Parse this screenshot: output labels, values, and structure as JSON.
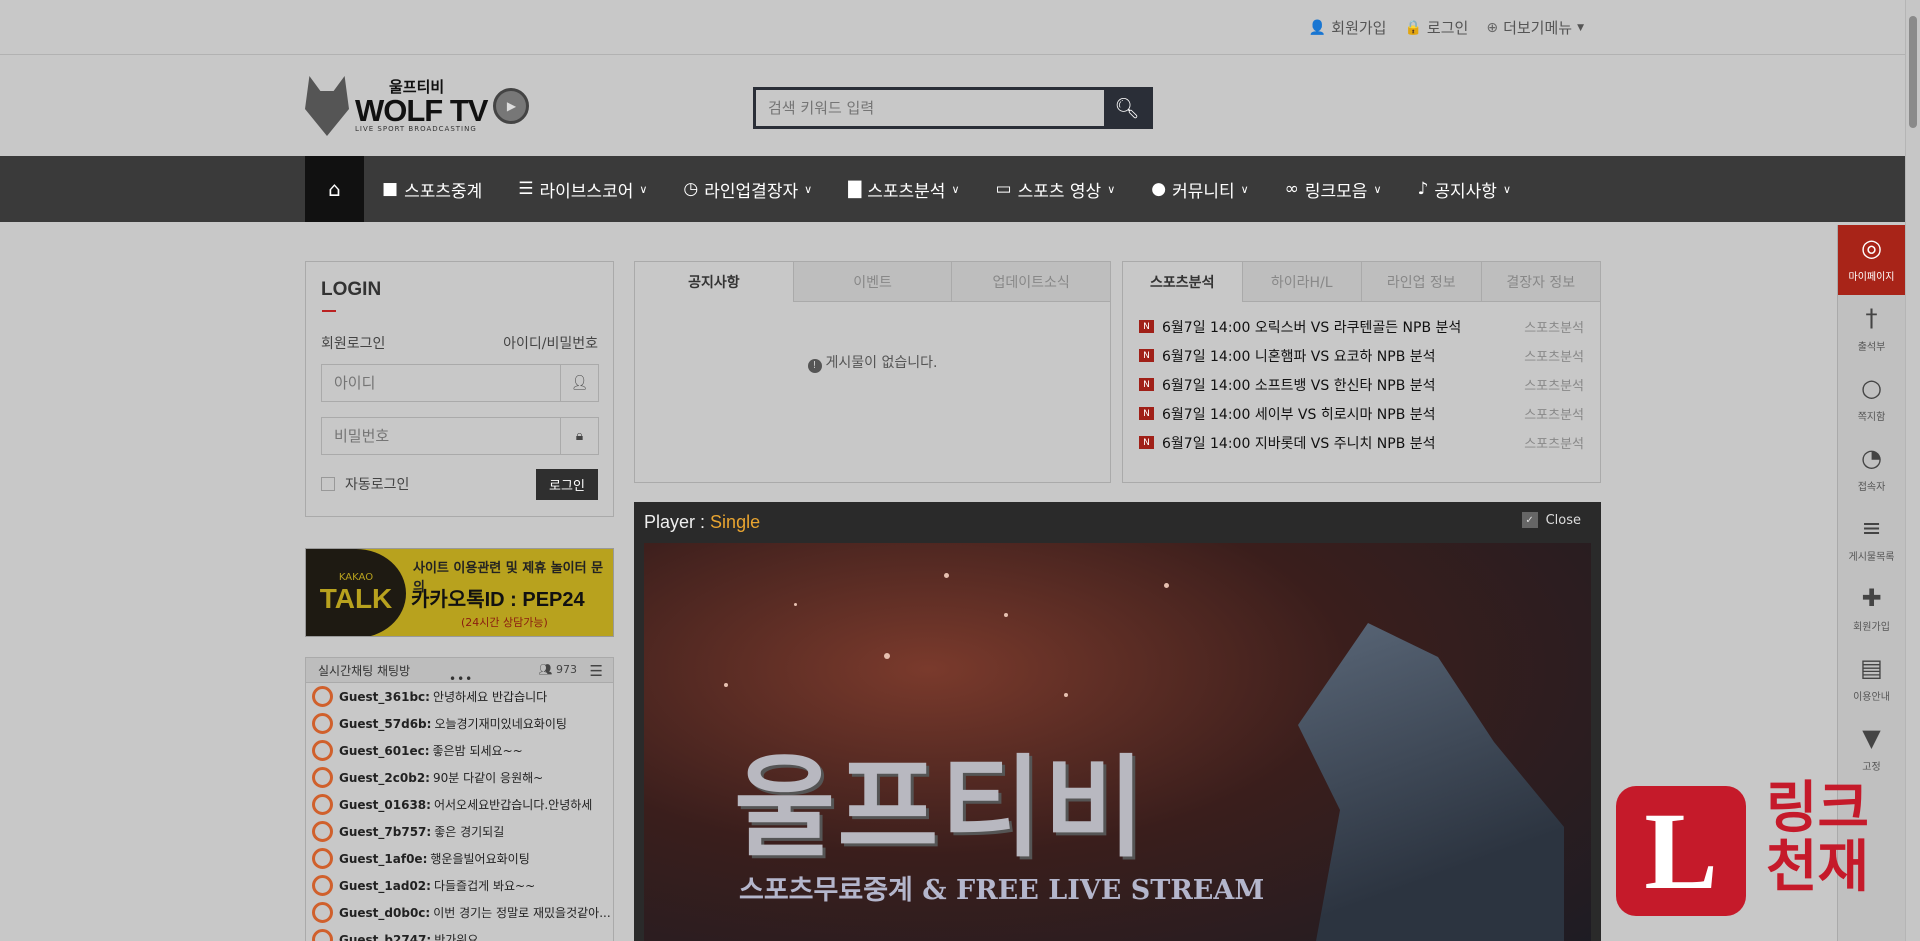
{
  "toplinks": [
    {
      "icon": "user-plus-icon",
      "label": "회원가입"
    },
    {
      "icon": "lock-icon",
      "label": "로그인"
    },
    {
      "icon": "plus-circle-icon",
      "label": "더보기메뉴"
    }
  ],
  "logo": {
    "korean": "울프티비",
    "english": "WOLF TV",
    "tagline": "LIVE SPORT BROADCASTING"
  },
  "search": {
    "placeholder": "검색 키워드 입력"
  },
  "nav": [
    {
      "icon": "video-icon",
      "label": "스포츠중계",
      "dropdown": false
    },
    {
      "icon": "list-icon",
      "label": "라이브스코어",
      "dropdown": true
    },
    {
      "icon": "clock-icon",
      "label": "라인업결장자",
      "dropdown": true
    },
    {
      "icon": "bar-chart-icon",
      "label": "스포츠분석",
      "dropdown": true
    },
    {
      "icon": "monitor-icon",
      "label": "스포츠 영상",
      "dropdown": true
    },
    {
      "icon": "comments-icon",
      "label": "커뮤니티",
      "dropdown": true
    },
    {
      "icon": "link-icon",
      "label": "링크모음",
      "dropdown": true
    },
    {
      "icon": "bell-icon",
      "label": "공지사항",
      "dropdown": true
    }
  ],
  "login": {
    "title": "LOGIN",
    "label_left": "회원로그인",
    "label_right": "아이디/비밀번호",
    "id_placeholder": "아이디",
    "pw_placeholder": "비밀번호",
    "remember_label": "자동로그인",
    "submit_label": "로그인"
  },
  "kakao": {
    "brand_top": "KAKAO",
    "brand_main": "TALK",
    "line1": "사이트 이용관련 및 제휴 놀이터 문의",
    "line2": "카카오톡ID : PEP24",
    "line3": "(24시간 상담가능)"
  },
  "chat": {
    "title": "실시간채팅 채팅방",
    "count": "973",
    "messages": [
      {
        "user": "Guest_361bc:",
        "text": "안녕하세요 반갑습니다"
      },
      {
        "user": "Guest_57d6b:",
        "text": "오늘경기재미있네요화이팅"
      },
      {
        "user": "Guest_601ec:",
        "text": "좋은밤 되세요~~"
      },
      {
        "user": "Guest_2c0b2:",
        "text": "90분 다같이 응원해~"
      },
      {
        "user": "Guest_01638:",
        "text": "어서오세요반갑습니다.안녕하세"
      },
      {
        "user": "Guest_7b757:",
        "text": "좋은 경기되길"
      },
      {
        "user": "Guest_1af0e:",
        "text": "행운을빌어요화이팅"
      },
      {
        "user": "Guest_1ad02:",
        "text": "다들즐겁게 봐요~~"
      },
      {
        "user": "Guest_d0b0c:",
        "text": "이번 경기는 정말로 재밌을것같아..."
      },
      {
        "user": "Guest_b2747:",
        "text": "반가워요"
      }
    ]
  },
  "notice": {
    "tabs": [
      "공지사항",
      "이벤트",
      "업데이트소식"
    ],
    "empty": "게시물이 없습니다."
  },
  "news": {
    "tabs": [
      "스포츠분석",
      "하이라H/L",
      "라인업 정보",
      "결장자 정보"
    ],
    "items": [
      {
        "text": "6월7일 14:00 오릭스버 VS 라쿠텐골든 NPB 분석",
        "meta": "스포츠분석"
      },
      {
        "text": "6월7일 14:00 니혼햄파 VS 요코하 NPB 분석",
        "meta": "스포츠분석"
      },
      {
        "text": "6월7일 14:00 소프트뱅 VS 한신타 NPB 분석",
        "meta": "스포츠분석"
      },
      {
        "text": "6월7일 14:00 세이부 VS 히로시마 NPB 분석",
        "meta": "스포츠분석"
      },
      {
        "text": "6월7일 14:00 지바롯데 VS 주니치 NPB 분석",
        "meta": "스포츠분석"
      }
    ]
  },
  "player": {
    "title_label": "Player :",
    "title_value": "Single",
    "close_label": "Close",
    "big_text": "울프티비",
    "sub_text": "스포츠무료중계 & FREE LIVE STREAM"
  },
  "sidebar": [
    {
      "icon": "user-circle-icon",
      "label": "마이페이지"
    },
    {
      "icon": "child-icon",
      "label": "출석부"
    },
    {
      "icon": "comment-icon",
      "label": "쪽지함"
    },
    {
      "icon": "user-clock-icon",
      "label": "접속자"
    },
    {
      "icon": "list-alt-icon",
      "label": "게시물목록"
    },
    {
      "icon": "user-add-icon",
      "label": "회원가입"
    },
    {
      "icon": "book-reader-icon",
      "label": "이용안내"
    },
    {
      "icon": "thumbtack-icon",
      "label": "고정"
    }
  ],
  "badge": {
    "letter": "L",
    "text_line1": "링크",
    "text_line2": "천재"
  }
}
